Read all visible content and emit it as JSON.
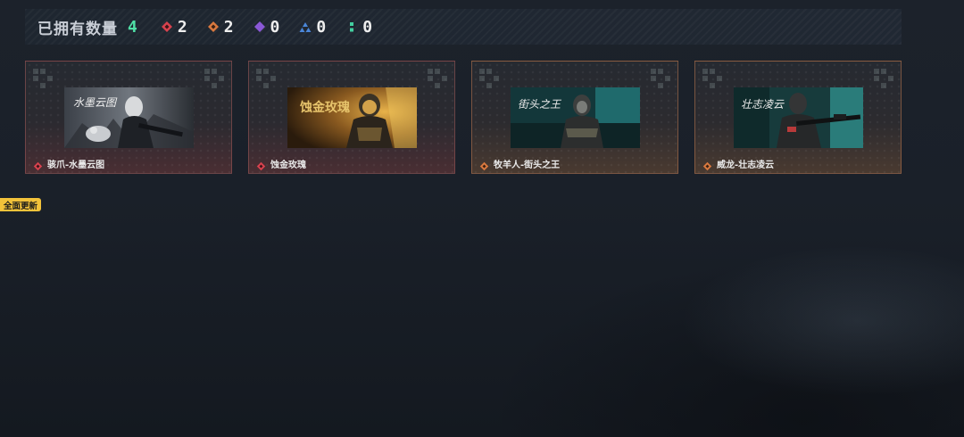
{
  "summary": {
    "title": "已拥有数量",
    "total": "4",
    "rarities": [
      {
        "icon": "red-diamond-icon",
        "color": "#d8424e",
        "count": "2"
      },
      {
        "icon": "orange-diamond-icon",
        "color": "#d9793f",
        "count": "2"
      },
      {
        "icon": "purple-diamond-icon",
        "color": "#8a58d6",
        "count": "0"
      },
      {
        "icon": "blue-triangle-icon",
        "color": "#4a86d8",
        "count": "0"
      },
      {
        "icon": "green-dots-icon",
        "color": "#43cfa0",
        "count": "0"
      }
    ]
  },
  "cards": [
    {
      "name": "骇爪-水墨云图",
      "rarity": "red",
      "art_title": "水墨云图",
      "gem_color": "#d8424e"
    },
    {
      "name": "蚀金玫瑰",
      "rarity": "red",
      "art_title": "蚀金玫瑰",
      "gem_color": "#d8424e"
    },
    {
      "name": "牧羊人-街头之王",
      "rarity": "orange",
      "art_title": "街头之王",
      "gem_color": "#d9793f"
    },
    {
      "name": "威龙-壮志凌云",
      "rarity": "orange",
      "art_title": "壮志凌云",
      "gem_color": "#d9793f"
    }
  ],
  "badge": {
    "label": "全面更新"
  }
}
